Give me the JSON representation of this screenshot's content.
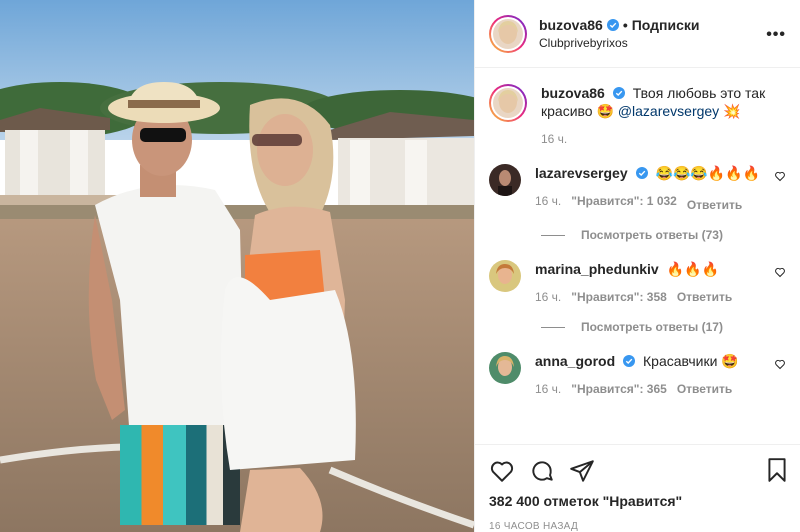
{
  "header": {
    "username": "buzova86",
    "separator": "•",
    "follow_label": "Подписки",
    "location": "Clubprivebyrixos",
    "more": "•••"
  },
  "caption": {
    "username": "buzova86",
    "text": "Твоя любовь это так красиво",
    "emoji1": "🤩",
    "mention": "@lazarevsergey",
    "emoji2": "💥",
    "time": "16 ч."
  },
  "comments": [
    {
      "username": "lazarevsergey",
      "text": "😂😂😂🔥🔥🔥",
      "time": "16 ч.",
      "likes": "\"Нравится\": 1 032",
      "reply": "Ответить",
      "view_replies": "Посмотреть ответы (73)"
    },
    {
      "username": "marina_phedunkiv",
      "text": "🔥🔥🔥",
      "time": "16 ч.",
      "likes": "\"Нравится\": 358",
      "reply": "Ответить",
      "view_replies": "Посмотреть ответы (17)"
    },
    {
      "username": "anna_gorod",
      "text": "Красавчики 🤩",
      "time": "16 ч.",
      "likes": "\"Нравится\": 365",
      "reply": "Ответить"
    }
  ],
  "footer": {
    "likes": "382 400 отметок \"Нравится\"",
    "posted_ago": "16 ЧАСОВ НАЗАД"
  },
  "icons": {
    "like": "heart-icon",
    "comment": "comment-icon",
    "share": "share-icon",
    "save": "bookmark-icon",
    "verified": "verified-badge-icon"
  },
  "colors": {
    "verified_blue": "#3897f0",
    "text": "#262626",
    "meta": "#8e8e8e",
    "border": "#efefef"
  }
}
